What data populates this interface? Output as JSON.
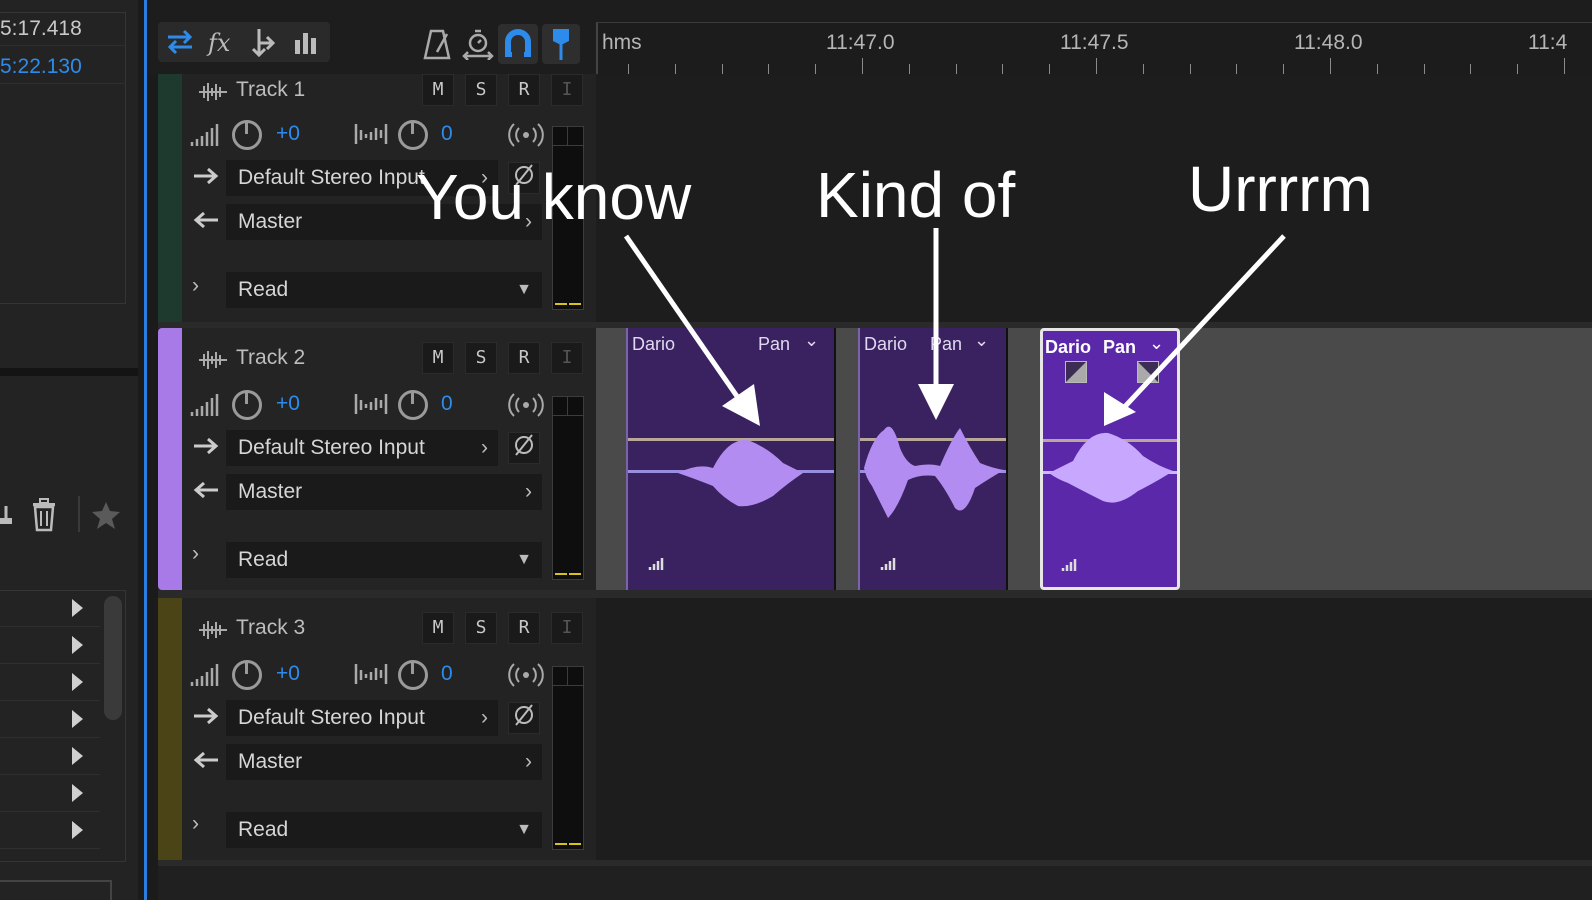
{
  "left_panel": {
    "time_start": "5:17.418",
    "time_end": "5:22.130",
    "list_rows": 7
  },
  "toolbar": {
    "buttons": [
      "switch-icon",
      "fx-icon",
      "route-icon",
      "levels-icon"
    ],
    "right_buttons": [
      "metronome-icon",
      "timer-icon",
      "snap-icon",
      "marker-icon"
    ]
  },
  "ruler": {
    "unit_label": "hms",
    "labels": [
      "11:47.0",
      "11:47.5",
      "11:48.0",
      "11:4"
    ]
  },
  "tracks": [
    {
      "name": "Track 1",
      "volume": "+0",
      "pan": "0",
      "input": "Default Stereo Input",
      "output": "Master",
      "automation": "Read",
      "color": "#1e3a2e",
      "mute": "M",
      "solo": "S",
      "record": "R",
      "input_mon": "I"
    },
    {
      "name": "Track 2",
      "volume": "+0",
      "pan": "0",
      "input": "Default Stereo Input",
      "output": "Master",
      "automation": "Read",
      "color": "#a77ae8",
      "mute": "M",
      "solo": "S",
      "record": "R",
      "input_mon": "I"
    },
    {
      "name": "Track 3",
      "volume": "+0",
      "pan": "0",
      "input": "Default Stereo Input",
      "output": "Master",
      "automation": "Read",
      "color": "#4a4416",
      "mute": "M",
      "solo": "S",
      "record": "R",
      "input_mon": "I"
    }
  ],
  "clips": [
    {
      "name": "Dario",
      "label2": "Pan"
    },
    {
      "name": "Dario",
      "label2": "Pan"
    },
    {
      "name": "Dario",
      "label2": "Pan"
    }
  ],
  "annotations": [
    "You know",
    "Kind of",
    "Urrrrm"
  ],
  "colors": {
    "accent": "#2d8ceb",
    "clip": "#3a2160",
    "clip_selected": "#5a28a8",
    "wave": "#b28cf0"
  }
}
